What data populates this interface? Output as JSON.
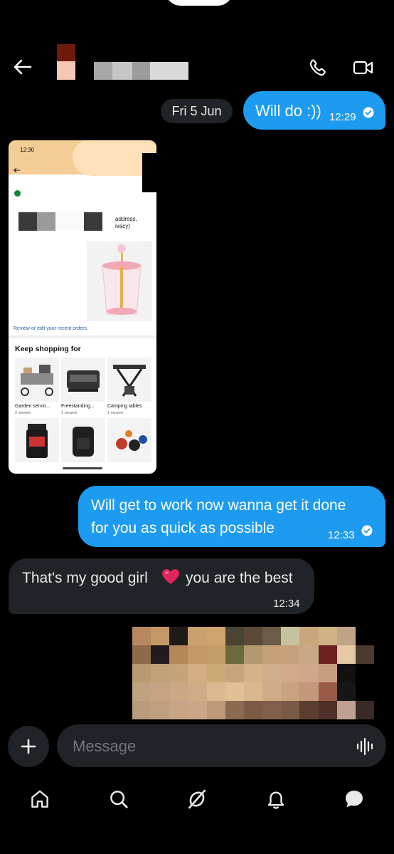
{
  "header": {
    "back_icon": "arrow-left-icon",
    "call_icon": "phone-icon",
    "video_icon": "video-camera-icon"
  },
  "conversation": {
    "date_chip": "Fri 5 Jun",
    "messages": [
      {
        "direction": "out",
        "text": "Will do :))",
        "time": "12:29",
        "read": true
      },
      {
        "direction": "in",
        "type": "image"
      },
      {
        "direction": "out",
        "lines": [
          "Will get to work now wanna get it done",
          "for you as quick as possible"
        ],
        "time": "12:33",
        "read": true
      },
      {
        "direction": "in",
        "text_before": "That's my good girl",
        "emoji": "❤️",
        "text_after": "you are the best",
        "time": "12:34"
      },
      {
        "direction": "out",
        "type": "image"
      }
    ]
  },
  "screenshot": {
    "status_time": "12:30",
    "address_text": [
      "address,",
      "ivacy)"
    ],
    "review_link": "Review or edit your recent orders",
    "keep_shopping": "Keep shopping for",
    "tiles": [
      {
        "label": "Garden servin...",
        "sub": "2 viewed"
      },
      {
        "label": "Freestanding...",
        "sub": "1 viewed"
      },
      {
        "label": "Camping tables",
        "sub": "1 viewed"
      }
    ]
  },
  "composer": {
    "placeholder": "Message",
    "add_icon": "plus-icon",
    "voice_icon": "voice-wave-icon"
  },
  "bottom_nav": [
    "home-icon",
    "search-icon",
    "grok-icon",
    "bell-icon",
    "messages-icon"
  ],
  "colors": {
    "background": "#000000",
    "outgoing_bubble": "#1d9bf0",
    "incoming_bubble": "#202327",
    "placeholder": "#71767b"
  }
}
